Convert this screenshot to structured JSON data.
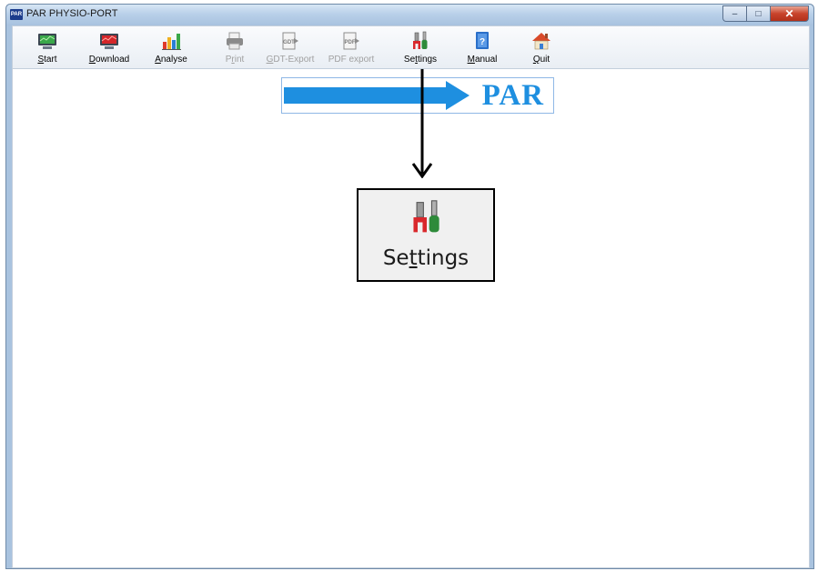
{
  "window": {
    "title": "PAR PHYSIO-PORT",
    "app_icon_text": "PAR",
    "controls": {
      "minimize": "–",
      "maximize": "□",
      "close": "✕"
    }
  },
  "toolbar": {
    "items": [
      {
        "label": "Start",
        "icon": "monitor-green-icon",
        "enabled": true
      },
      {
        "label": "Download",
        "icon": "monitor-red-icon",
        "enabled": true
      },
      {
        "label": "Analyse",
        "icon": "bar-chart-icon",
        "enabled": true
      },
      {
        "label": "Print",
        "icon": "printer-icon",
        "enabled": false
      },
      {
        "label": "GDT-Export",
        "icon": "gdt-export-icon",
        "enabled": false
      },
      {
        "label": "PDF export",
        "icon": "pdf-export-icon",
        "enabled": false
      },
      {
        "label": "Settings",
        "icon": "tools-icon",
        "enabled": true
      },
      {
        "label": "Manual",
        "icon": "manual-book-icon",
        "enabled": true
      },
      {
        "label": "Quit",
        "icon": "home-exit-icon",
        "enabled": true
      }
    ]
  },
  "banner": {
    "brand": "PAR"
  },
  "callout": {
    "label": "Settings",
    "icon": "tools-icon"
  },
  "colors": {
    "brand_blue": "#1e8fe0",
    "title_bar": "#b9d0e9",
    "close_red": "#c8432b"
  }
}
